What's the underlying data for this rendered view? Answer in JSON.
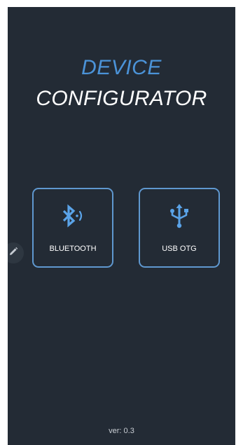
{
  "app": {
    "title_line1": "DEVICE",
    "title_line2": "CONFIGURATOR"
  },
  "connections": [
    {
      "label": "BLUETOOTH",
      "icon": "bluetooth-icon"
    },
    {
      "label": "USB OTG",
      "icon": "usb-icon"
    }
  ],
  "side_handle": {
    "icon": "pencil-icon"
  },
  "footer": {
    "version": "ver: 0.3"
  },
  "colors": {
    "background": "#232b35",
    "accent": "#4b93d8",
    "button_border": "#5f98cf",
    "text": "#ffffff"
  }
}
